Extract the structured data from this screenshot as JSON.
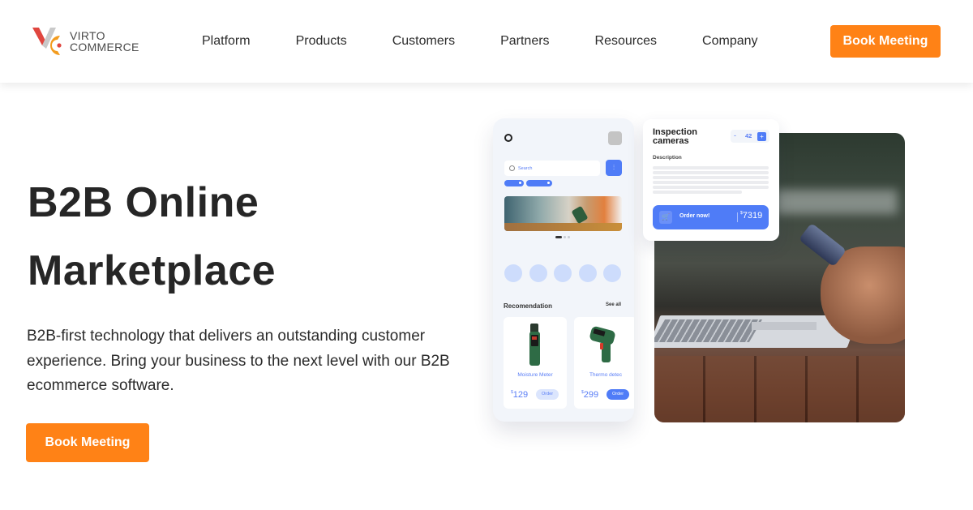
{
  "header": {
    "logo": {
      "line1": "VIRTO",
      "line2": "COMMERCE"
    },
    "nav": [
      {
        "label": "Platform"
      },
      {
        "label": "Products"
      },
      {
        "label": "Customers"
      },
      {
        "label": "Partners"
      },
      {
        "label": "Resources"
      },
      {
        "label": "Company"
      }
    ],
    "cta_label": "Book Meeting"
  },
  "hero": {
    "title_line1": "B2B Online",
    "title_line2": "Marketplace",
    "description": "B2B-first technology that delivers an outstanding customer experience. Bring your business to the next level with our B2B ecommerce software.",
    "cta_label": "Book Meeting"
  },
  "mockup": {
    "search_placeholder": "Search",
    "recommendation_title": "Recomendation",
    "see_all_label": "See all",
    "products": [
      {
        "name": "Moisture Meter",
        "currency": "$",
        "price": "129",
        "order_label": "Order"
      },
      {
        "name": "Thermo detec",
        "currency": "$",
        "price": "299",
        "order_label": "Order"
      }
    ],
    "detail": {
      "title": "Inspection cameras",
      "quantity": "42",
      "minus": "-",
      "plus": "+",
      "description_label": "Description",
      "order_label": "Order now!",
      "currency": "$",
      "price": "7319"
    }
  },
  "colors": {
    "accent_orange": "#ff8216",
    "accent_blue": "#4f7cf7",
    "text_dark": "#262626"
  }
}
